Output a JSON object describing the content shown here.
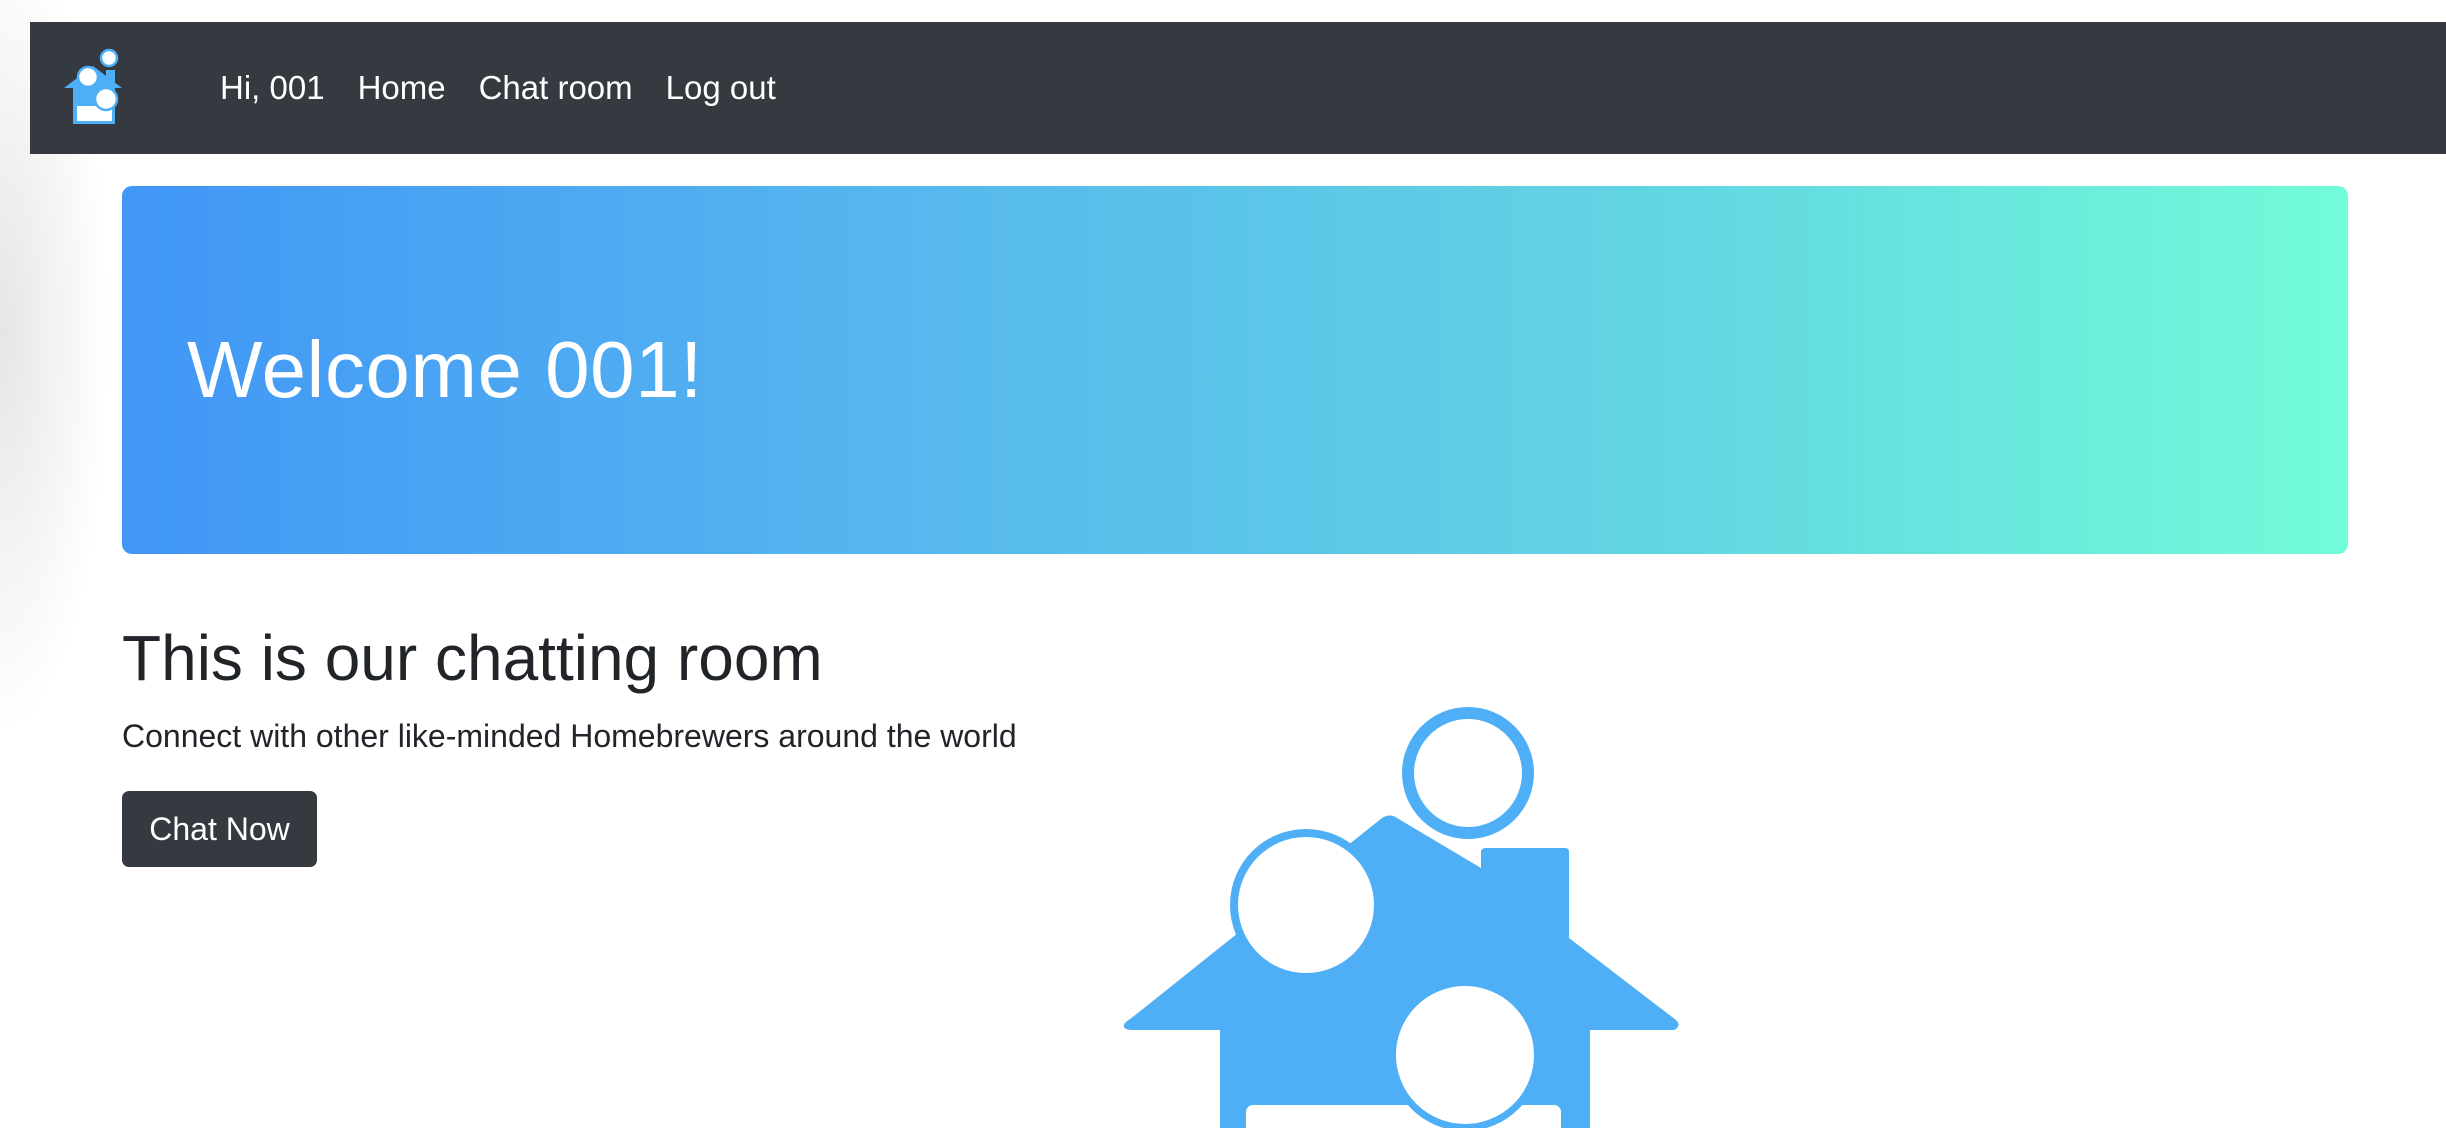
{
  "navbar": {
    "logo_icon": "homebrew-house-logo-icon",
    "greeting": "Hi, 001",
    "links": [
      {
        "label": "Home"
      },
      {
        "label": "Chat room"
      },
      {
        "label": "Log out"
      }
    ],
    "background": "#343a40"
  },
  "hero": {
    "title": "Welcome 001!",
    "gradient_start": "#4196f6",
    "gradient_end": "#72fcd8"
  },
  "section": {
    "title": "This is our chatting room",
    "subtitle": "Connect with other like-minded Homebrewers around the world",
    "button_label": "Chat Now"
  },
  "illustration": {
    "icon": "people-house-illustration-icon",
    "color": "#4eaff6"
  }
}
